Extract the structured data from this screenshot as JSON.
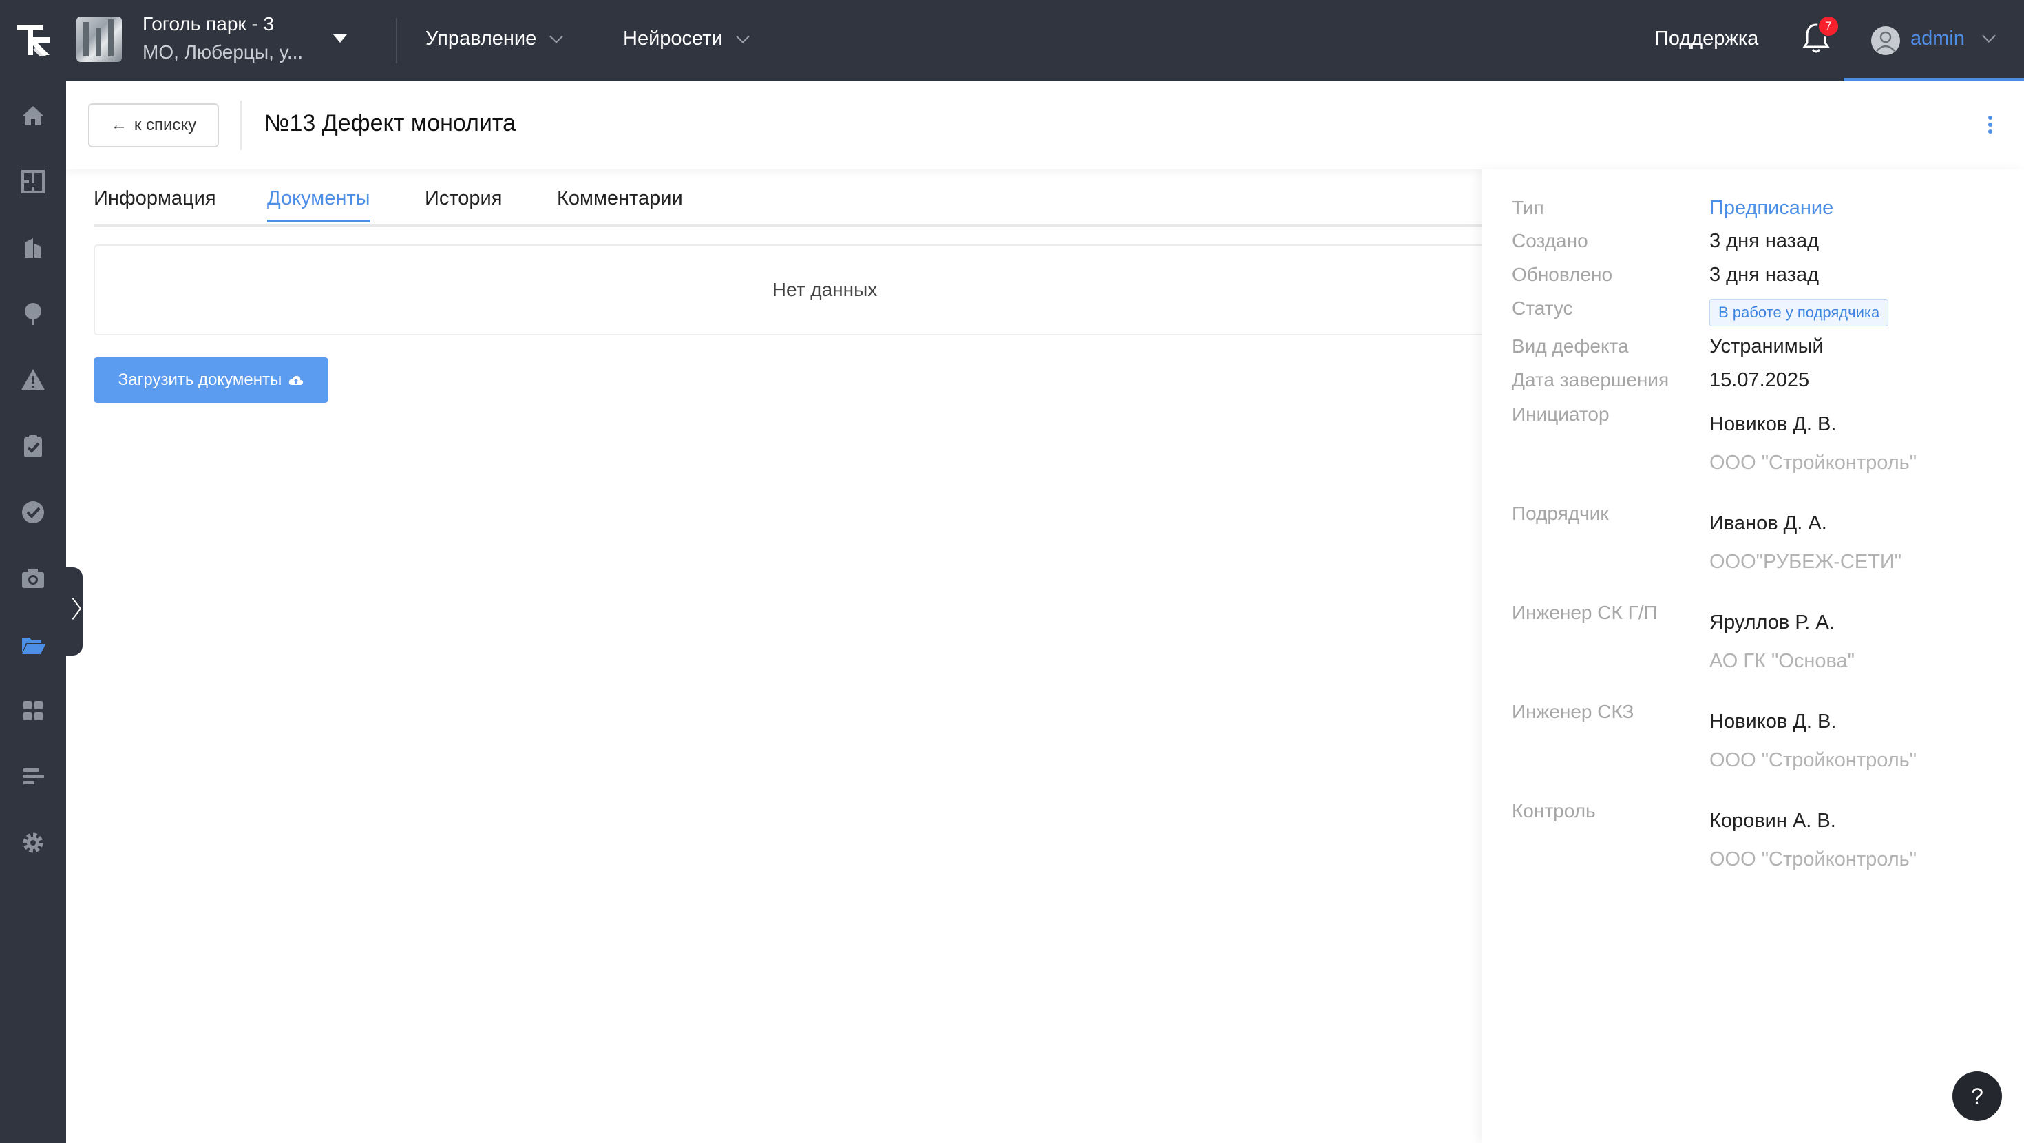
{
  "topbar": {
    "project_name": "Гоголь парк - 3",
    "project_address": "МО, Люберцы, у...",
    "menu": [
      {
        "label": "Управление"
      },
      {
        "label": "Нейросети"
      }
    ],
    "support_label": "Поддержка",
    "notifications_count": "7",
    "user_name": "admin"
  },
  "sidebar": {
    "items": [
      {
        "icon": "home-icon"
      },
      {
        "icon": "floor-plan-icon"
      },
      {
        "icon": "buildings-icon"
      },
      {
        "icon": "tree-icon"
      },
      {
        "icon": "warning-icon"
      },
      {
        "icon": "clipboard-check-icon"
      },
      {
        "icon": "check-circle-icon"
      },
      {
        "icon": "camera-icon"
      },
      {
        "icon": "folder-open-icon",
        "active": true
      },
      {
        "icon": "dashboard-icon"
      },
      {
        "icon": "bar-list-icon"
      },
      {
        "icon": "gear-icon"
      }
    ]
  },
  "header": {
    "back_label": "к списку",
    "title": "№13 Дефект монолита"
  },
  "tabs": [
    {
      "label": "Информация"
    },
    {
      "label": "Документы",
      "active": true
    },
    {
      "label": "История"
    },
    {
      "label": "Комментарии"
    }
  ],
  "documents": {
    "empty_text": "Нет данных",
    "upload_label": "Загрузить документы"
  },
  "details": {
    "type_label": "Тип",
    "type_value": "Предписание",
    "created_label": "Создано",
    "created_value": "3 дня назад",
    "updated_label": "Обновлено",
    "updated_value": "3 дня назад",
    "status_label": "Статус",
    "status_value": "В работе у подрядчика",
    "defect_kind_label": "Вид дефекта",
    "defect_kind_value": "Устранимый",
    "due_label": "Дата завершения",
    "due_value": "15.07.2025",
    "people": [
      {
        "role": "Инициатор",
        "name": "Новиков Д. В.",
        "org": "ООО \"Стройконтроль\""
      },
      {
        "role": "Подрядчик",
        "name": "Иванов Д. А.",
        "org": "ООО\"РУБЕЖ-СЕТИ\""
      },
      {
        "role": "Инженер СК Г/П",
        "name": "Яруллов Р. А.",
        "org": "АО ГК \"Основа\""
      },
      {
        "role": "Инженер СКЗ",
        "name": "Новиков Д. В.",
        "org": "ООО \"Стройконтроль\""
      },
      {
        "role": "Контроль",
        "name": "Коровин А. В.",
        "org": "ООО \"Стройконтроль\""
      }
    ]
  },
  "help_label": "?",
  "colors": {
    "dark": "#30353f",
    "accent": "#4d8fe6",
    "button": "#5b9bf0",
    "badge": "#f5222d"
  }
}
